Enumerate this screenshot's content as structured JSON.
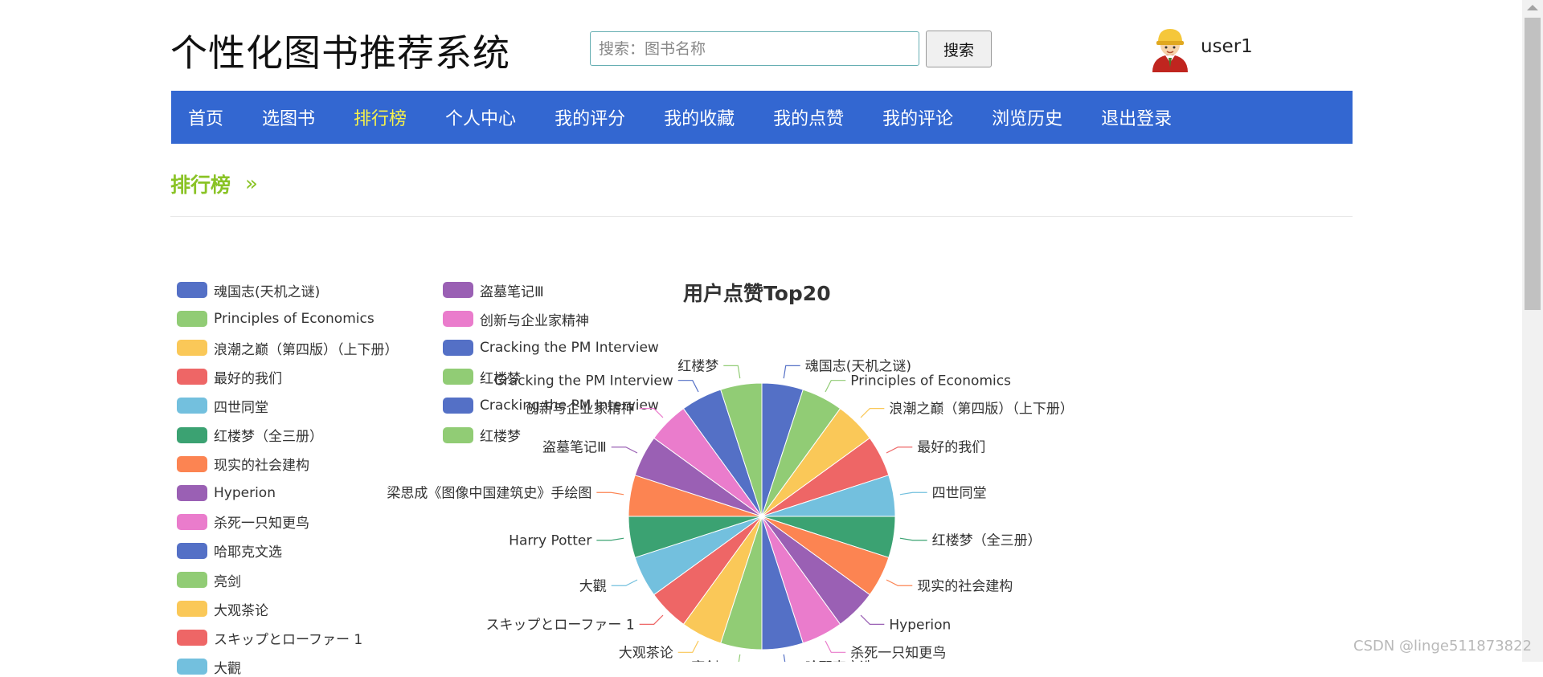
{
  "header": {
    "site_title": "个性化图书推荐系统",
    "search_placeholder": "搜索：图书名称",
    "search_value": "",
    "search_button": "搜索",
    "username": "user1"
  },
  "nav": [
    {
      "label": "首页",
      "active": false
    },
    {
      "label": "选图书",
      "active": false
    },
    {
      "label": "排行榜",
      "active": true
    },
    {
      "label": "个人中心",
      "active": false
    },
    {
      "label": "我的评分",
      "active": false
    },
    {
      "label": "我的收藏",
      "active": false
    },
    {
      "label": "我的点赞",
      "active": false
    },
    {
      "label": "我的评论",
      "active": false
    },
    {
      "label": "浏览历史",
      "active": false
    },
    {
      "label": "退出登录",
      "active": false
    }
  ],
  "section": {
    "heading": "排行榜",
    "chevron": "»"
  },
  "watermark": "CSDN @linge511873822",
  "colors": {
    "nav_bg": "#3367d1",
    "nav_active": "#f7f24a",
    "heading": "#8ac326",
    "palette": [
      "#5470c6",
      "#91cc75",
      "#fac858",
      "#ee6666",
      "#73c0de",
      "#3ba272",
      "#fc8452",
      "#9a60b4",
      "#ea7ccc"
    ]
  },
  "chart_data": {
    "type": "pie",
    "title": "用户点赞Top20",
    "legend_position": "left",
    "categories": [
      "魂国志(天机之谜)",
      "Principles of Economics",
      "浪潮之巅（第四版）（上下册）",
      "最好的我们",
      "四世同堂",
      "红楼梦（全三册）",
      "现实的社会建构",
      "Hyperion",
      "杀死一只知更鸟",
      "哈耶克文选",
      "亮剑",
      "大观茶论",
      "スキップとローファー 1",
      "大觀",
      "Harry Potter",
      "梁思成《图像中国建筑史》手绘图",
      "盗墓笔记Ⅲ",
      "创新与企业家精神",
      "Cracking the PM Interview",
      "红楼梦"
    ],
    "values": [
      1,
      1,
      1,
      1,
      1,
      1,
      1,
      1,
      1,
      1,
      1,
      1,
      1,
      1,
      1,
      1,
      1,
      1,
      1,
      1
    ]
  }
}
